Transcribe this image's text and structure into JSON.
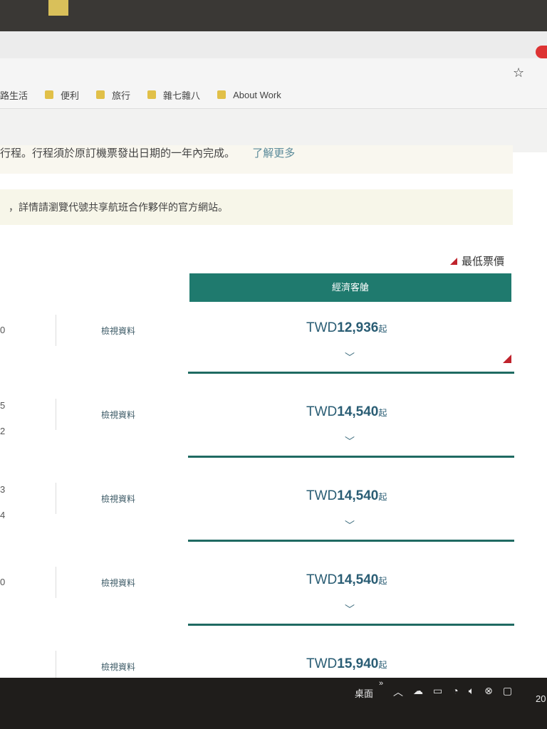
{
  "browser": {
    "bookmarks": [
      {
        "label": "路生活",
        "has_folder_icon": false
      },
      {
        "label": "便利",
        "has_folder_icon": true
      },
      {
        "label": "旅行",
        "has_folder_icon": true
      },
      {
        "label": "雜七雜八",
        "has_folder_icon": true
      },
      {
        "label": "About Work",
        "has_folder_icon": true
      }
    ]
  },
  "notice": {
    "line1": "行程。行程須於原訂機票發出日期的一年內完成。",
    "line1_link": "了解更多",
    "line2": "，詳情請瀏覽代號共享航班合作夥伴的官方網站。"
  },
  "legend": {
    "lowest_fare_label": "最低票價",
    "lowest_fare_color": "#c0232c"
  },
  "cabin": {
    "label": "經濟客艙",
    "color": "#1f7a6e"
  },
  "flights": [
    {
      "nums": [
        "0"
      ],
      "info_label": "檢視資料",
      "currency": "TWD",
      "amount": "12,936",
      "suffix": "起",
      "lowest": true
    },
    {
      "nums": [
        "5",
        "2"
      ],
      "info_label": "檢視資料",
      "currency": "TWD",
      "amount": "14,540",
      "suffix": "起",
      "lowest": false
    },
    {
      "nums": [
        "3",
        "4"
      ],
      "info_label": "檢視資料",
      "currency": "TWD",
      "amount": "14,540",
      "suffix": "起",
      "lowest": false
    },
    {
      "nums": [
        "0"
      ],
      "info_label": "檢視資料",
      "currency": "TWD",
      "amount": "14,540",
      "suffix": "起",
      "lowest": false
    },
    {
      "nums": [],
      "info_label": "檢視資料",
      "currency": "TWD",
      "amount": "15,940",
      "suffix": "起",
      "lowest": false
    }
  ],
  "taskbar": {
    "desktop_label": "桌面",
    "clock": "20"
  }
}
